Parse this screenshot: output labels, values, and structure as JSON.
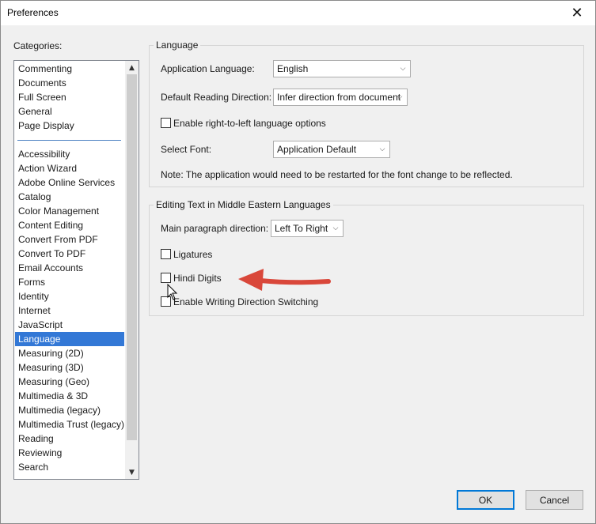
{
  "window": {
    "title": "Preferences",
    "close_glyph": "✕"
  },
  "categories": {
    "label": "Categories:",
    "items_top": [
      "Commenting",
      "Documents",
      "Full Screen",
      "General",
      "Page Display"
    ],
    "items_bottom": [
      "Accessibility",
      "Action Wizard",
      "Adobe Online Services",
      "Catalog",
      "Color Management",
      "Content Editing",
      "Convert From PDF",
      "Convert To PDF",
      "Email Accounts",
      "Forms",
      "Identity",
      "Internet",
      "JavaScript",
      "Language",
      "Measuring (2D)",
      "Measuring (3D)",
      "Measuring (Geo)",
      "Multimedia & 3D",
      "Multimedia (legacy)",
      "Multimedia Trust (legacy)",
      "Reading",
      "Reviewing",
      "Search"
    ],
    "selected": "Language"
  },
  "language": {
    "title": "Language",
    "app_lang_label": "Application Language:",
    "app_lang_value": "English",
    "reading_dir_label": "Default Reading Direction:",
    "reading_dir_value": "Infer direction from document",
    "rtl_label": "Enable right-to-left language options",
    "rtl_checked": false,
    "font_label": "Select Font:",
    "font_value": "Application Default",
    "note": "Note: The application would need to be restarted for the font change to be reflected."
  },
  "middle_east": {
    "title": "Editing Text in Middle Eastern Languages",
    "para_dir_label": "Main paragraph direction:",
    "para_dir_value": "Left To Right",
    "ligatures_label": "Ligatures",
    "ligatures_checked": false,
    "hindi_label": "Hindi Digits",
    "hindi_checked": false,
    "switching_label": "Enable Writing Direction Switching",
    "switching_checked": false
  },
  "buttons": {
    "ok": "OK",
    "cancel": "Cancel"
  },
  "icons": {
    "dropdown": "chevron-down-icon",
    "scroll_up": "scroll-up-arrow-icon",
    "scroll_down": "scroll-down-arrow-icon",
    "annotation": "red-arrow-annotation-icon",
    "cursor": "mouse-pointer-icon"
  },
  "colors": {
    "selection": "#3378d6",
    "annotation_arrow": "#d9473a",
    "default_button_border": "#0078d7"
  }
}
